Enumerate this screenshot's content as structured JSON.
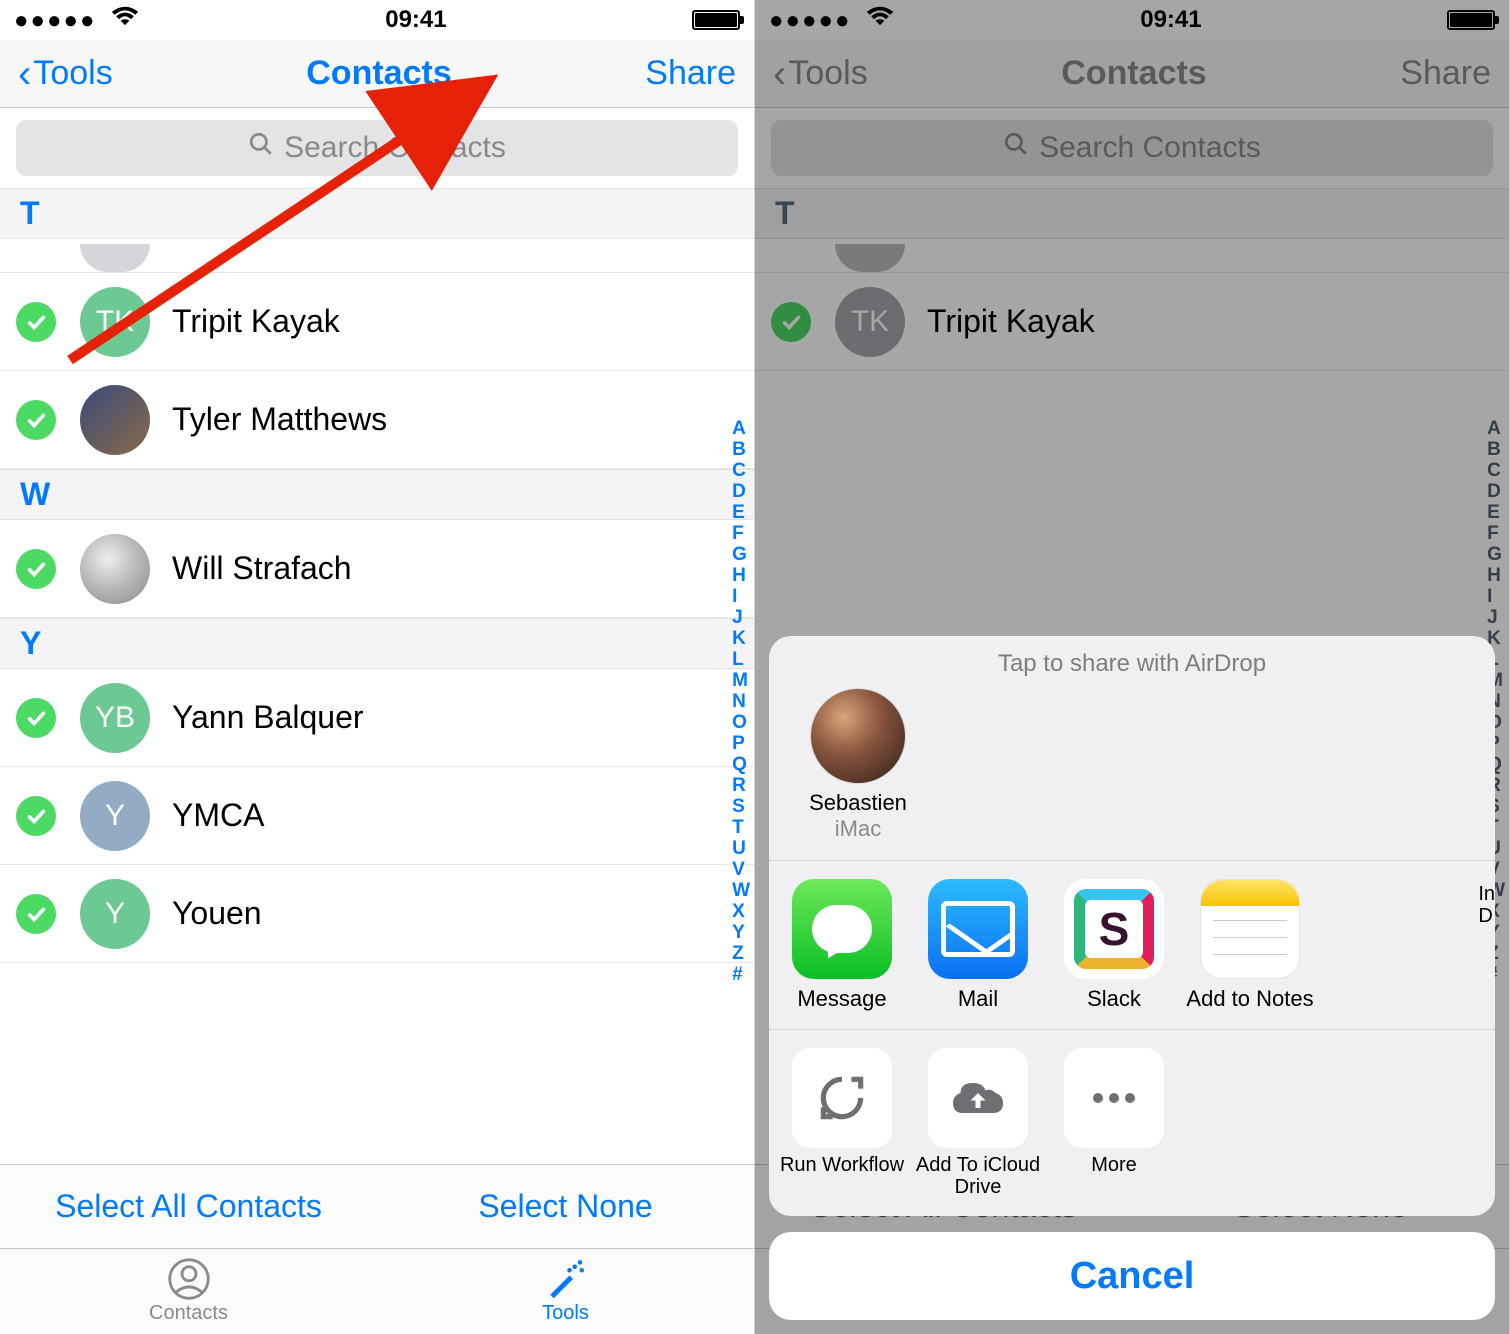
{
  "status": {
    "time": "09:41"
  },
  "nav": {
    "back": "Tools",
    "title": "Contacts",
    "share": "Share"
  },
  "search": {
    "placeholder": "Search Contacts"
  },
  "sections": [
    {
      "letter": "T",
      "contacts": [
        {
          "name": "Tripit Kayak",
          "initials": "TK",
          "avatar": "initials-green"
        },
        {
          "name": "Tyler Matthews",
          "initials": "",
          "avatar": "photo1"
        }
      ]
    },
    {
      "letter": "W",
      "contacts": [
        {
          "name": "Will Strafach",
          "initials": "",
          "avatar": "photo2"
        }
      ]
    },
    {
      "letter": "Y",
      "contacts": [
        {
          "name": "Yann Balquer",
          "initials": "YB",
          "avatar": "initials-green"
        },
        {
          "name": "YMCA",
          "initials": "Y",
          "avatar": "initials-blue"
        },
        {
          "name": "Youen",
          "initials": "Y",
          "avatar": "initials-green"
        }
      ]
    }
  ],
  "index_rail": [
    "A",
    "B",
    "C",
    "D",
    "E",
    "F",
    "G",
    "H",
    "I",
    "J",
    "K",
    "L",
    "M",
    "N",
    "O",
    "P",
    "Q",
    "R",
    "S",
    "T",
    "U",
    "V",
    "W",
    "X",
    "Y",
    "Z",
    "#"
  ],
  "bottom": {
    "select_all": "Select All Contacts",
    "select_none": "Select None"
  },
  "tabs": {
    "contacts": "Contacts",
    "tools": "Tools"
  },
  "share_sheet": {
    "airdrop_title": "Tap to share with AirDrop",
    "airdrop": {
      "name": "Sebastien",
      "device": "iMac"
    },
    "apps": [
      {
        "label": "Message"
      },
      {
        "label": "Mail"
      },
      {
        "label": "Slack"
      },
      {
        "label": "Add to Notes"
      }
    ],
    "peek": {
      "l1": "In",
      "l2": "D"
    },
    "actions": [
      {
        "label": "Run Workflow"
      },
      {
        "label": "Add To iCloud Drive"
      },
      {
        "label": "More"
      }
    ],
    "cancel": "Cancel"
  }
}
